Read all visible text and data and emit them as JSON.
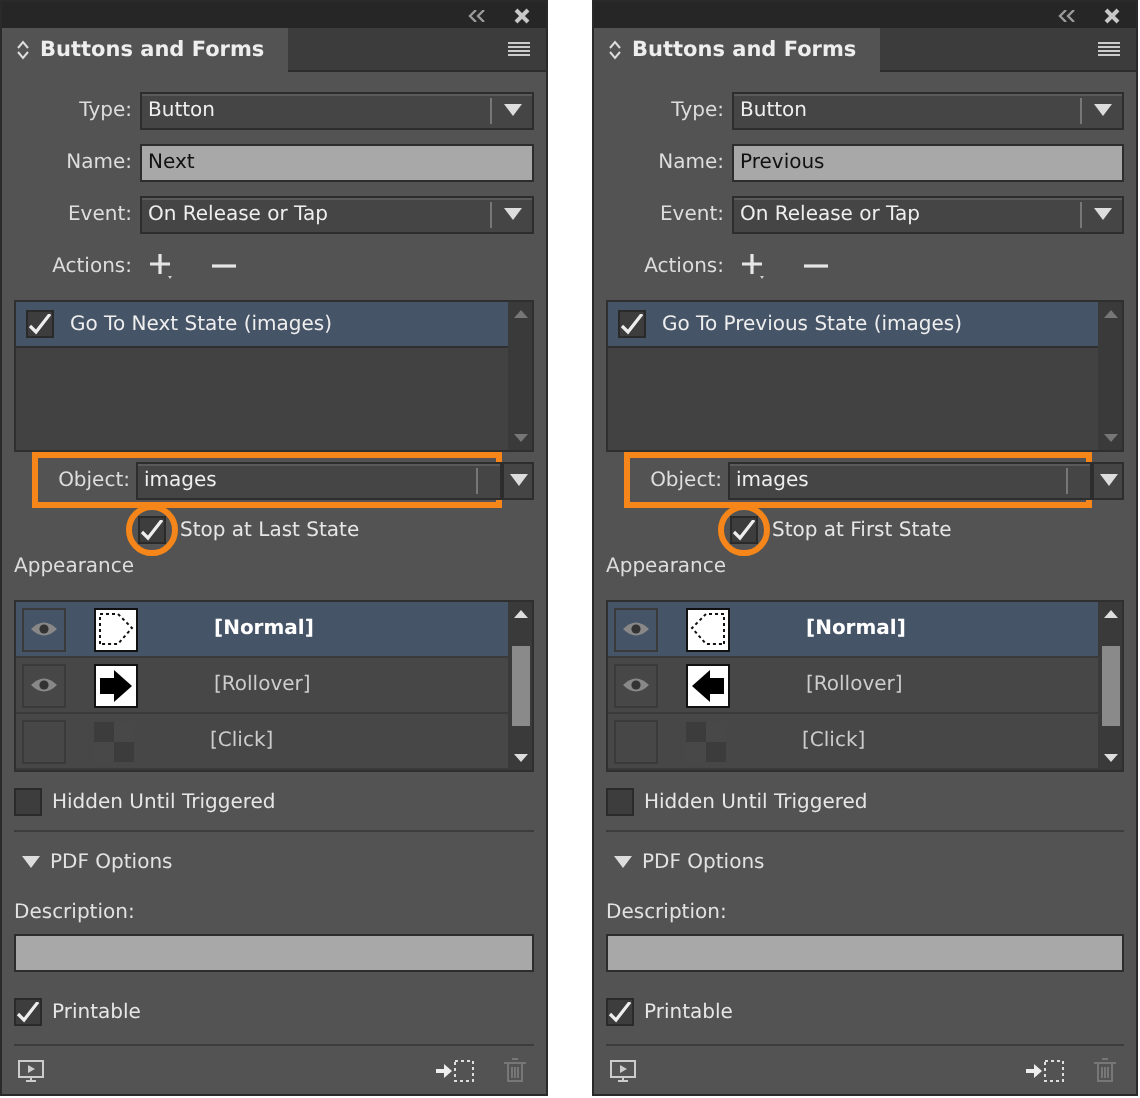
{
  "panels": [
    {
      "title": "Buttons and Forms",
      "type_label": "Type:",
      "type": "Button",
      "name_label": "Name:",
      "name": "Next",
      "event_label": "Event:",
      "event": "On Release or Tap",
      "actions_label": "Actions:",
      "actions": [
        {
          "label": "Go To Next State (images)",
          "checked": true,
          "selected": true
        }
      ],
      "object_label": "Object:",
      "object": "images",
      "object_highlighted": true,
      "stop": {
        "label": "Stop at Last State",
        "checked": true,
        "highlighted": true
      },
      "appearance_label": "Appearance",
      "states": [
        {
          "label": "[Normal]",
          "selected": true,
          "visible": true,
          "kind": "outline-right"
        },
        {
          "label": "[Rollover]",
          "selected": false,
          "visible": true,
          "kind": "arrow-right"
        },
        {
          "label": "[Click]",
          "selected": false,
          "visible": false,
          "kind": "blank"
        }
      ],
      "hidden": {
        "label": "Hidden Until Triggered",
        "checked": false
      },
      "pdf_options": {
        "label": "PDF Options",
        "expanded": true
      },
      "description_label": "Description:",
      "printable": {
        "label": "Printable",
        "checked": true
      }
    },
    {
      "title": "Buttons and Forms",
      "type_label": "Type:",
      "type": "Button",
      "name_label": "Name:",
      "name": "Previous",
      "event_label": "Event:",
      "event": "On Release or Tap",
      "actions_label": "Actions:",
      "actions": [
        {
          "label": "Go To Previous State (images)",
          "checked": true,
          "selected": true
        }
      ],
      "object_label": "Object:",
      "object": "images",
      "object_highlighted": true,
      "stop": {
        "label": "Stop at First State",
        "checked": true,
        "highlighted": true
      },
      "appearance_label": "Appearance",
      "states": [
        {
          "label": "[Normal]",
          "selected": true,
          "visible": true,
          "kind": "outline-left"
        },
        {
          "label": "[Rollover]",
          "selected": false,
          "visible": true,
          "kind": "arrow-left"
        },
        {
          "label": "[Click]",
          "selected": false,
          "visible": false,
          "kind": "blank"
        }
      ],
      "hidden": {
        "label": "Hidden Until Triggered",
        "checked": false
      },
      "pdf_options": {
        "label": "PDF Options",
        "expanded": true
      },
      "description_label": "Description:",
      "printable": {
        "label": "Printable",
        "checked": true
      }
    }
  ]
}
